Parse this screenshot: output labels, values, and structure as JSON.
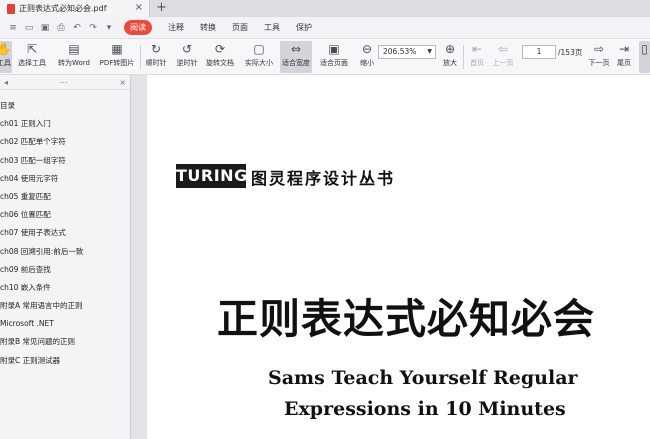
{
  "tab": {
    "title": "正则表达式必知必会.pdf",
    "close": "×",
    "new_tab": "+"
  },
  "menubar": {
    "read_label": "阅读",
    "items": [
      "注释",
      "转换",
      "页面",
      "工具",
      "保护"
    ]
  },
  "toolbar": {
    "items": [
      {
        "label": "工具",
        "icon": "hand-icon"
      },
      {
        "label": "选择工具",
        "icon": "cursor-icon"
      },
      {
        "label": "转为Word",
        "icon": "word-icon"
      },
      {
        "label": "PDF转图片",
        "icon": "image-icon"
      },
      {
        "label": "顺时针",
        "icon": "rotate-cw-icon"
      },
      {
        "label": "逆时针",
        "icon": "rotate-ccw-icon"
      },
      {
        "label": "旋转文档",
        "icon": "rotate-doc-icon"
      },
      {
        "label": "实际大小",
        "icon": "actual-size-icon"
      },
      {
        "label": "适合宽度",
        "icon": "fit-width-icon"
      },
      {
        "label": "适合页面",
        "icon": "fit-page-icon"
      },
      {
        "label": "缩小",
        "icon": "zoom-out-icon"
      },
      {
        "label": "放大",
        "icon": "zoom-in-icon"
      },
      {
        "label": "首页",
        "icon": "first-page-icon"
      },
      {
        "label": "上一页",
        "icon": "prev-page-icon"
      },
      {
        "label": "下一页",
        "icon": "next-page-icon"
      },
      {
        "label": "尾页",
        "icon": "last-page-icon"
      }
    ],
    "zoom_value": "206.53%",
    "page_current": "1",
    "page_total": "/153页"
  },
  "sidebar": {
    "outline": [
      "目录",
      "ch01 正则入门",
      "ch02 匹配单个字符",
      "ch03 匹配一组字符",
      "ch04 使用元字符",
      "ch05 重复匹配",
      "ch06 位置匹配",
      "ch07 使用子表达式",
      "ch08 回溯引用:前后一致",
      "ch09 前后查找",
      "ch10 嵌入条件",
      "附录A 常用语言中的正则",
      "Microsoft .NET",
      "附录B 常见问题的正则",
      "附录C 正则测试器"
    ]
  },
  "page": {
    "logo": "TURING",
    "series": "图灵程序设计丛书",
    "cn_title": "正则表达式必知必会",
    "en_title_line1": "Sams Teach Yourself Regular",
    "en_title_line2": "Expressions in 10 Minutes"
  },
  "colors": {
    "accent": "#e74c3c"
  }
}
